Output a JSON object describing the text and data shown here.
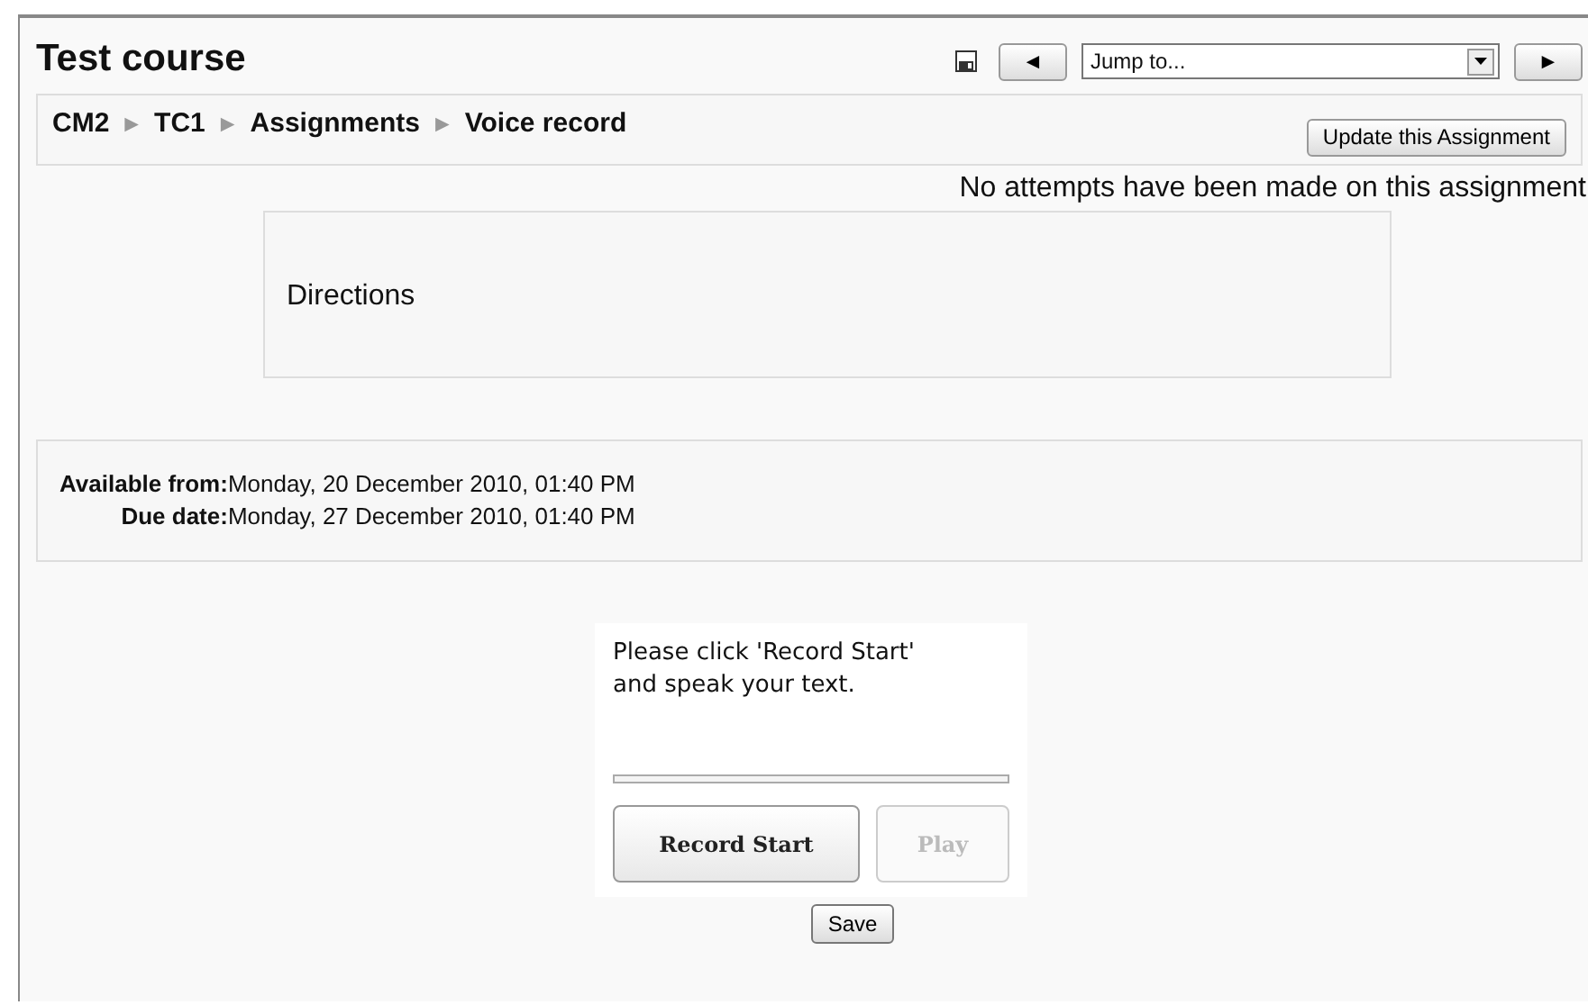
{
  "course_title": "Test course",
  "nav": {
    "prev": "◄",
    "jump": {
      "value": "Jump to..."
    },
    "next": "►"
  },
  "breadcrumb": [
    "CM2",
    "TC1",
    "Assignments",
    "Voice record"
  ],
  "breadcrumb_separator": "►",
  "update_button": "Update this Assignment",
  "attempts_note": "No attempts have been made on this assignment",
  "directions": "Directions",
  "dates": [
    {
      "label": "Available from:",
      "value": "Monday, 20 December 2010, 01:40 PM"
    },
    {
      "label": "Due date:",
      "value": "Monday, 27 December 2010, 01:40 PM"
    }
  ],
  "recorder": {
    "instructions": "Please click 'Record Start' and speak your text.",
    "progress": {
      "level": 0
    },
    "buttons": [
      {
        "label": "Record Start",
        "disabled": false
      },
      {
        "label": "Play",
        "disabled": true
      }
    ]
  },
  "save_button": "Save"
}
